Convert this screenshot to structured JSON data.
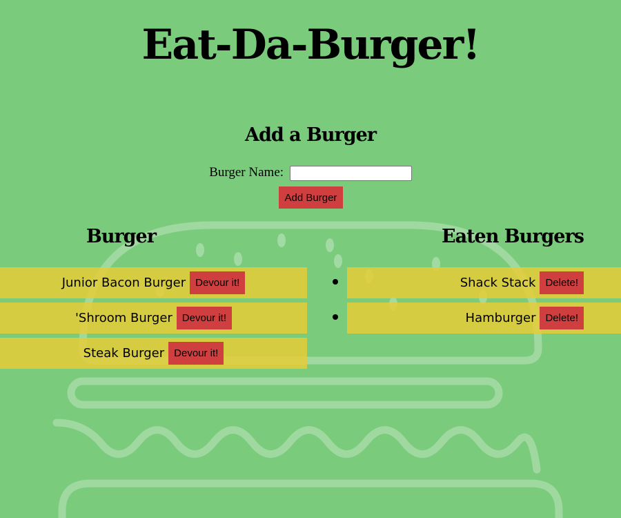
{
  "page": {
    "title": "Eat-Da-Burger!"
  },
  "add_form": {
    "heading": "Add a Burger",
    "name_label": "Burger Name:",
    "name_value": "",
    "submit_label": "Add Burger"
  },
  "burgers": {
    "heading": "Burger",
    "action_label": "Devour it!",
    "items": [
      {
        "name": "Junior Bacon Burger"
      },
      {
        "name": "'Shroom Burger"
      },
      {
        "name": "Steak Burger"
      }
    ]
  },
  "eaten": {
    "heading": "Eaten Burgers",
    "action_label": "Delete!",
    "items": [
      {
        "name": "Shack Stack"
      },
      {
        "name": "Hamburger"
      }
    ]
  },
  "colors": {
    "background": "#7acb7c",
    "row": "#e6cc38",
    "button": "#d03f3f"
  }
}
